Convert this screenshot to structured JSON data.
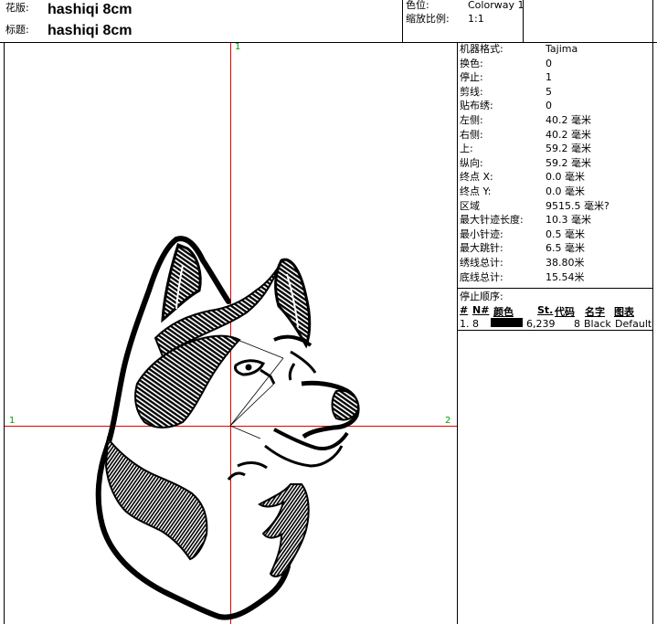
{
  "header": {
    "design_label": "花版:",
    "design_value": "hashiqi 8cm",
    "title_label": "标题:",
    "title_value": "hashiqi 8cm",
    "colorway_label": "色位:",
    "colorway_value": "Colorway 1",
    "scale_label": "缩放比例:",
    "scale_value": "1:1"
  },
  "info": [
    {
      "label": "机器格式:",
      "value": "Tajima"
    },
    {
      "label": "换色:",
      "value": "0"
    },
    {
      "label": "停止:",
      "value": "1"
    },
    {
      "label": "剪线:",
      "value": "5"
    },
    {
      "label": "贴布绣:",
      "value": "0"
    },
    {
      "label": "左侧:",
      "value": "40.2 毫米"
    },
    {
      "label": "右侧:",
      "value": "40.2 毫米"
    },
    {
      "label": "上:",
      "value": "59.2 毫米"
    },
    {
      "label": "纵向:",
      "value": "59.2 毫米"
    },
    {
      "label": "终点 X:",
      "value": "0.0 毫米"
    },
    {
      "label": "终点 Y:",
      "value": "0.0 毫米"
    },
    {
      "label": "区域",
      "value": "9515.5 毫米?"
    },
    {
      "label": "最大针迹长度:",
      "value": "10.3 毫米"
    },
    {
      "label": "最小针迹:",
      "value": "0.5 毫米"
    },
    {
      "label": "最大跳针:",
      "value": "6.5 毫米"
    },
    {
      "label": "绣线总计:",
      "value": "38.80米"
    },
    {
      "label": "底线总计:",
      "value": "15.54米"
    }
  ],
  "stop_sequence": {
    "title": "停止顺序:",
    "columns": {
      "num": "#",
      "needle": "N#",
      "color": "颜色",
      "stitches": "St.",
      "code": "代码",
      "name": "名字",
      "chart": "图表"
    },
    "rows": [
      {
        "num": "1.",
        "needle": "8",
        "swatch_color": "#000000",
        "stitches": "6,239",
        "code": "8",
        "name": "Black",
        "chart": "Default"
      }
    ]
  },
  "canvas": {
    "axis_labels": {
      "top": "1",
      "left": "1",
      "right": "2"
    }
  }
}
